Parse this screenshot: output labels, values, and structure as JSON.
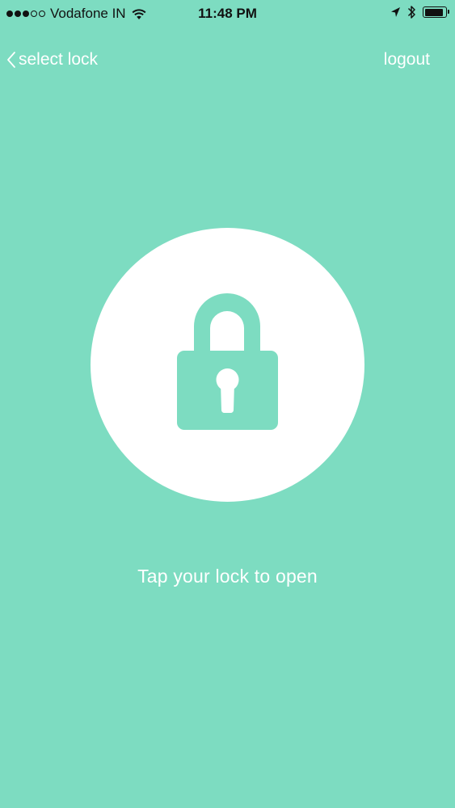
{
  "status_bar": {
    "carrier": "Vodafone IN",
    "time": "11:48 PM",
    "signal_bars_filled": 3,
    "signal_bars_total": 5,
    "icons": [
      "wifi-icon",
      "location-arrow-icon",
      "bluetooth-icon",
      "battery-icon"
    ],
    "battery_level": 0.9
  },
  "nav": {
    "back_label": "select lock",
    "back_icon": "chevron-left-icon",
    "logout_label": "logout"
  },
  "main": {
    "lock_icon": "padlock-icon",
    "hint": "Tap your lock to open"
  },
  "colors": {
    "background": "#7DDCC1",
    "circle": "#FFFFFF",
    "text": "#FFFFFF"
  }
}
